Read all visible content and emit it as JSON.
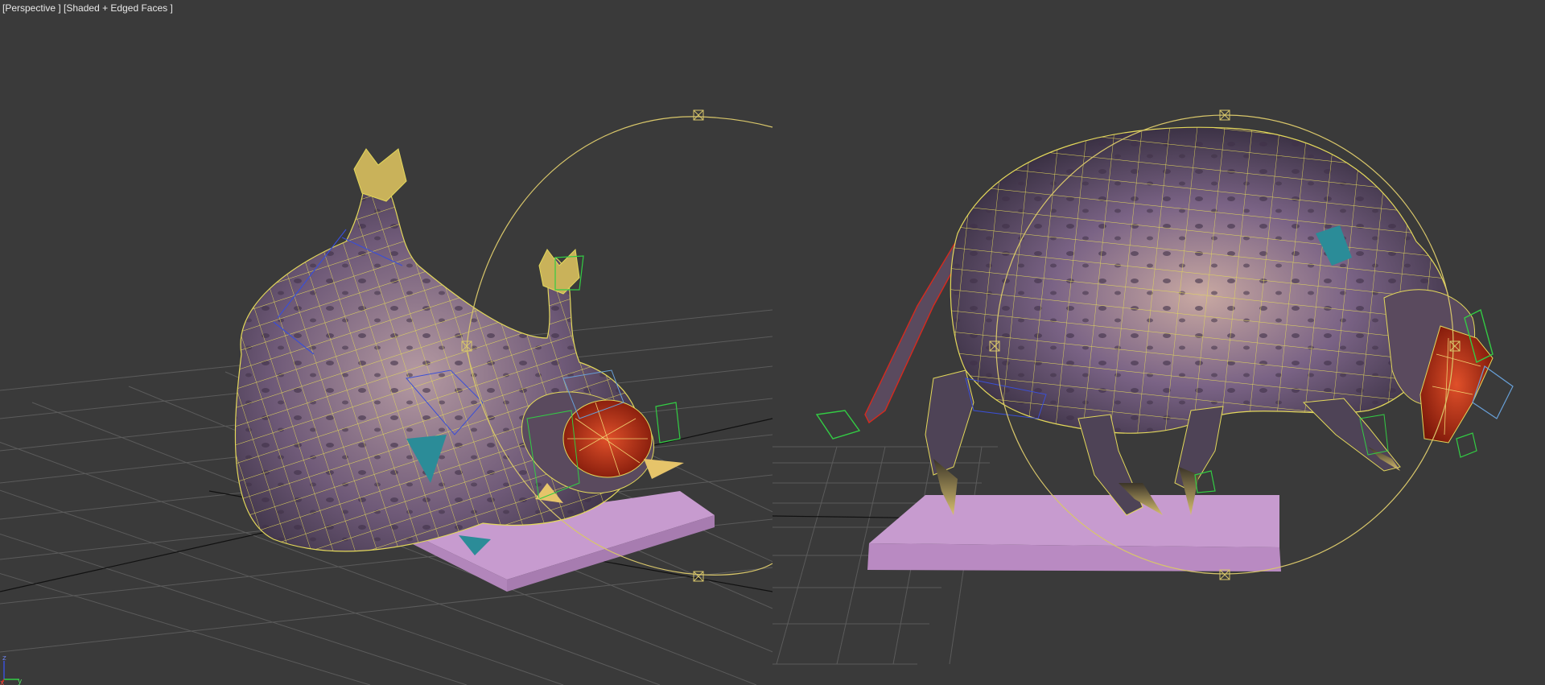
{
  "viewport": {
    "pov_label": "[Perspective ]",
    "shading_label": "[Shaded + Edged Faces ]"
  },
  "axis_gizmo": {
    "x_label": "x",
    "y_label": "y",
    "z_label": "z"
  },
  "colors": {
    "background": "#3a3a3a",
    "grid": "#5a5a5a",
    "grid_axis": "#111111",
    "wireframe": "#e3d85a",
    "creature_body": "#6b5670",
    "creature_body_light": "#a68a90",
    "mouth": "#b62c14",
    "platform": "#c89ad0",
    "bone_helper_red": "#d62a1e",
    "bone_helper_green": "#33cc44",
    "bone_helper_blue": "#3a4fd6",
    "cyan_helper": "#2b8c98",
    "selection_circle": "#d8c66a"
  }
}
